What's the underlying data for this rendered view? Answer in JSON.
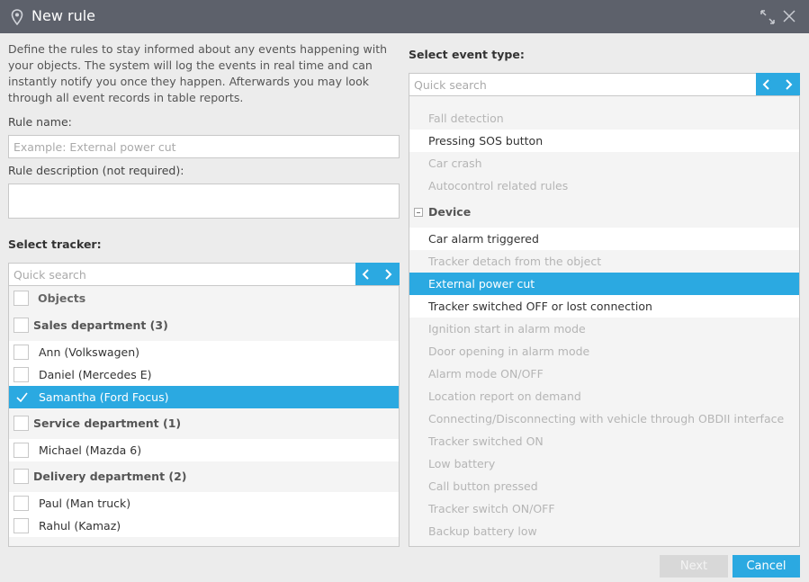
{
  "dialog": {
    "title": "New rule"
  },
  "intro": "Define the rules to stay informed about any events happening with your objects. The system will log the events in real time and can instantly notify you once they happen. Afterwards you may look through all event records in table reports.",
  "form": {
    "rule_name_label": "Rule name:",
    "rule_name_placeholder": "Example: External power cut",
    "rule_name_value": "",
    "rule_desc_label": "Rule description (not required):",
    "rule_desc_value": ""
  },
  "tracker": {
    "label": "Select tracker:",
    "search_placeholder": "Quick search",
    "header": "Objects",
    "items": [
      {
        "label": "Sales department (3)",
        "kind": "group"
      },
      {
        "label": "Ann (Volkswagen)",
        "kind": "item"
      },
      {
        "label": "Daniel (Mercedes E)",
        "kind": "item"
      },
      {
        "label": "Samantha (Ford Focus)",
        "kind": "item",
        "selected": true
      },
      {
        "label": "Service department (1)",
        "kind": "group"
      },
      {
        "label": "Michael (Mazda 6)",
        "kind": "item"
      },
      {
        "label": "Delivery department (2)",
        "kind": "group"
      },
      {
        "label": "Paul (Man truck)",
        "kind": "item"
      },
      {
        "label": "Rahul (Kamaz)",
        "kind": "item"
      }
    ]
  },
  "event": {
    "label": "Select event type:",
    "search_placeholder": "Quick search",
    "items": [
      {
        "label": "Fall detection",
        "enabled": false
      },
      {
        "label": "Pressing SOS button",
        "enabled": true
      },
      {
        "label": "Car crash",
        "enabled": false
      },
      {
        "label": "Autocontrol related rules",
        "enabled": false
      },
      {
        "label": "Device",
        "kind": "category"
      },
      {
        "label": "Car alarm triggered",
        "enabled": true
      },
      {
        "label": "Tracker detach from the object",
        "enabled": false
      },
      {
        "label": "External power cut",
        "enabled": true,
        "selected": true
      },
      {
        "label": "Tracker switched OFF or lost connection",
        "enabled": true
      },
      {
        "label": "Ignition start in alarm mode",
        "enabled": false
      },
      {
        "label": "Door opening in alarm mode",
        "enabled": false
      },
      {
        "label": "Alarm mode ON/OFF",
        "enabled": false
      },
      {
        "label": "Location report on demand",
        "enabled": false
      },
      {
        "label": "Connecting/Disconnecting with vehicle through OBDII interface",
        "enabled": false
      },
      {
        "label": "Tracker switched ON",
        "enabled": false
      },
      {
        "label": "Low battery",
        "enabled": false
      },
      {
        "label": "Call button pressed",
        "enabled": false
      },
      {
        "label": "Tracker switch ON/OFF",
        "enabled": false
      },
      {
        "label": "Backup battery low",
        "enabled": false
      }
    ]
  },
  "buttons": {
    "next": "Next",
    "cancel": "Cancel"
  },
  "colors": {
    "accent": "#2ba9e1",
    "titlebar": "#5d616b"
  }
}
